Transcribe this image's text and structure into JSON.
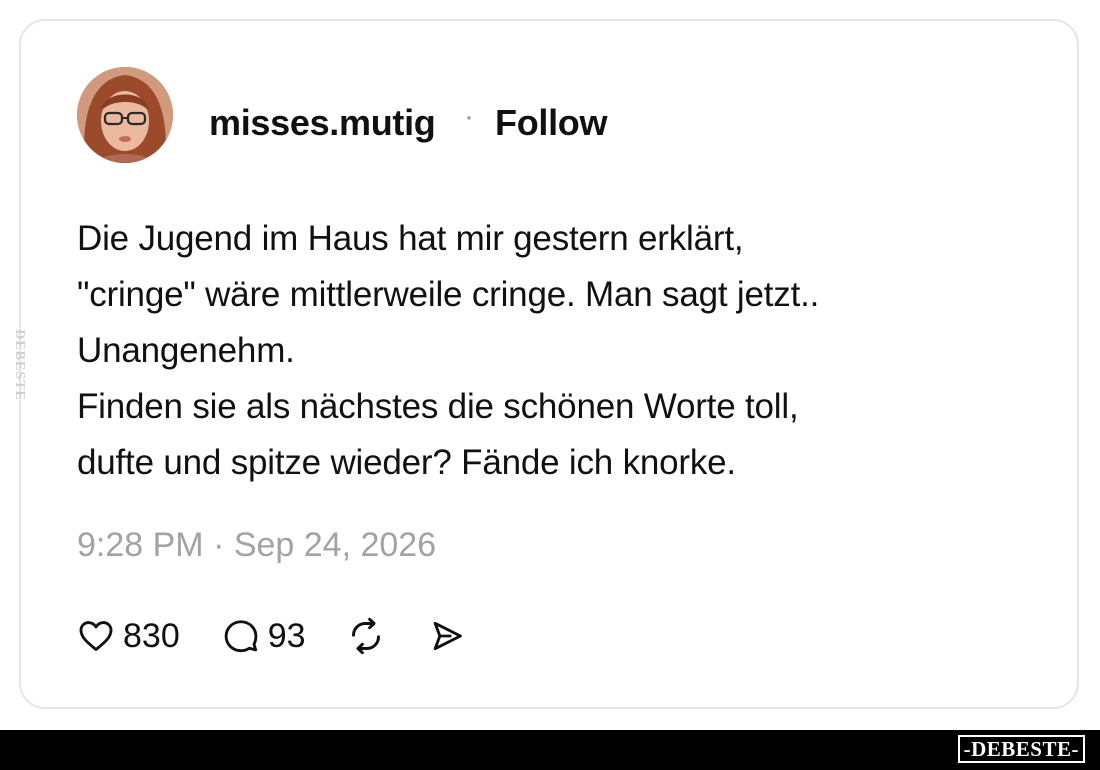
{
  "post": {
    "username": "misses.mutig",
    "separator": "·",
    "follow_label": "Follow",
    "text_lines": [
      "Die Jugend im Haus hat mir gestern erklärt,",
      "\"cringe\" wäre mittlerweile cringe. Man sagt jetzt..",
      "Unangenehm.",
      "Finden sie als nächstes die schönen Worte toll,",
      "dufte und spitze wieder? Fände ich knorke."
    ],
    "timestamp": "9:28 PM · Sep 24, 2026"
  },
  "actions": {
    "likes_count": "830",
    "replies_count": "93",
    "icons": [
      "heart-icon",
      "reply-icon",
      "repost-icon",
      "share-icon"
    ]
  },
  "watermark": {
    "footer_logo": "-DEBESTE-",
    "side_label": "DEBESTE"
  },
  "colors": {
    "text": "#111111",
    "muted": "#a3a3a3",
    "border": "#e4e4e4",
    "footer": "#000000"
  }
}
